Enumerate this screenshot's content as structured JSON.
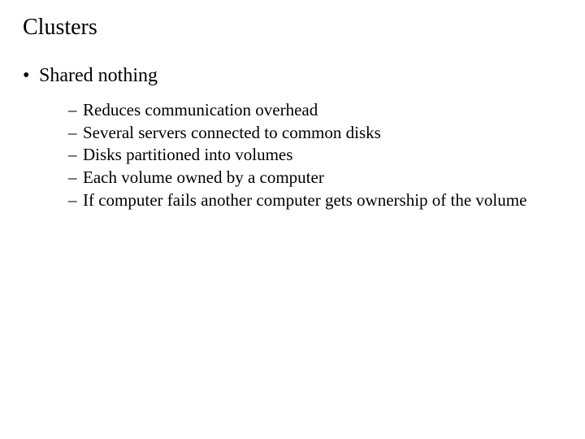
{
  "title": "Clusters",
  "topic": {
    "bullet": "•",
    "text": "Shared nothing"
  },
  "sub": {
    "dash": "–",
    "items": [
      "Reduces communication overhead",
      "Several servers connected to common disks",
      "Disks partitioned into volumes",
      "Each volume owned by a computer",
      "If computer fails another computer gets ownership of the volume"
    ]
  }
}
